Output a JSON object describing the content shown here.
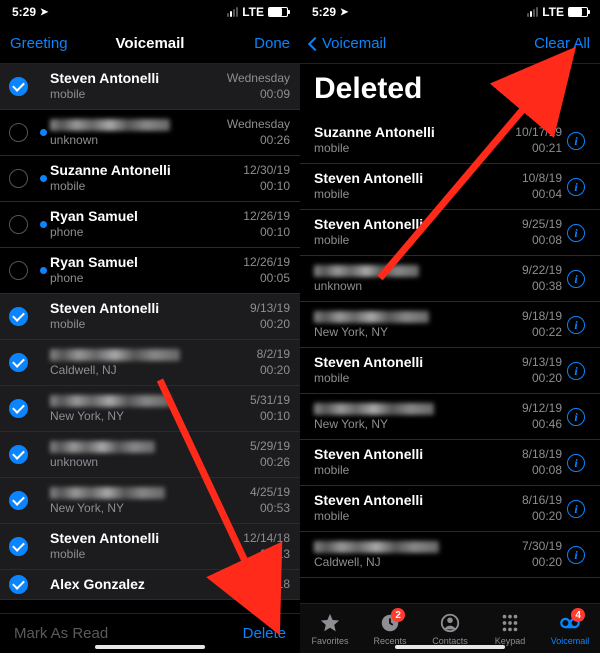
{
  "left": {
    "status": {
      "time": "5:29",
      "network": "LTE"
    },
    "nav": {
      "left": "Greeting",
      "title": "Voicemail",
      "right": "Done"
    },
    "rows": [
      {
        "name": "Steven Antonelli",
        "sub": "mobile",
        "date": "Wednesday",
        "dur": "00:09",
        "checked": true,
        "unread": false,
        "highlight": true,
        "blurred": false
      },
      {
        "name": "",
        "sub": "unknown",
        "date": "Wednesday",
        "dur": "00:26",
        "checked": false,
        "unread": true,
        "highlight": false,
        "blurred": true,
        "blurW": 120
      },
      {
        "name": "Suzanne Antonelli",
        "sub": "mobile",
        "date": "12/30/19",
        "dur": "00:10",
        "checked": false,
        "unread": true,
        "highlight": false,
        "blurred": false
      },
      {
        "name": "Ryan Samuel",
        "sub": "phone",
        "date": "12/26/19",
        "dur": "00:10",
        "checked": false,
        "unread": true,
        "highlight": false,
        "blurred": false
      },
      {
        "name": "Ryan Samuel",
        "sub": "phone",
        "date": "12/26/19",
        "dur": "00:05",
        "checked": false,
        "unread": true,
        "highlight": false,
        "blurred": false
      },
      {
        "name": "Steven Antonelli",
        "sub": "mobile",
        "date": "9/13/19",
        "dur": "00:20",
        "checked": true,
        "unread": false,
        "highlight": true,
        "blurred": false
      },
      {
        "name": "",
        "sub": "Caldwell, NJ",
        "date": "8/2/19",
        "dur": "00:20",
        "checked": true,
        "unread": false,
        "highlight": true,
        "blurred": true,
        "blurW": 130
      },
      {
        "name": "",
        "sub": "New York, NY",
        "date": "5/31/19",
        "dur": "00:10",
        "checked": true,
        "unread": false,
        "highlight": true,
        "blurred": true,
        "blurW": 120
      },
      {
        "name": "",
        "sub": "unknown",
        "date": "5/29/19",
        "dur": "00:26",
        "checked": true,
        "unread": false,
        "highlight": true,
        "blurred": true,
        "blurW": 105
      },
      {
        "name": "",
        "sub": "New York, NY",
        "date": "4/25/19",
        "dur": "00:53",
        "checked": true,
        "unread": false,
        "highlight": true,
        "blurred": true,
        "blurW": 115
      },
      {
        "name": "Steven Antonelli",
        "sub": "mobile",
        "date": "12/14/18",
        "dur": "00:13",
        "checked": true,
        "unread": false,
        "highlight": true,
        "blurred": false
      },
      {
        "name": "Alex Gonzalez",
        "sub": "",
        "date": "10/19/18",
        "dur": "",
        "checked": true,
        "unread": false,
        "highlight": true,
        "blurred": false,
        "partial": true
      }
    ],
    "toolbar": {
      "mark": "Mark As Read",
      "delete": "Delete"
    }
  },
  "right": {
    "status": {
      "time": "5:29",
      "network": "LTE"
    },
    "nav": {
      "back": "Voicemail",
      "right": "Clear All"
    },
    "title": "Deleted",
    "rows": [
      {
        "name": "Suzanne Antonelli",
        "sub": "mobile",
        "date": "10/17/19",
        "dur": "00:21",
        "blurred": false
      },
      {
        "name": "Steven Antonelli",
        "sub": "mobile",
        "date": "10/8/19",
        "dur": "00:04",
        "blurred": false
      },
      {
        "name": "Steven Antonelli",
        "sub": "mobile",
        "date": "9/25/19",
        "dur": "00:08",
        "blurred": false
      },
      {
        "name": "",
        "sub": "unknown",
        "date": "9/22/19",
        "dur": "00:38",
        "blurred": true,
        "blurW": 105
      },
      {
        "name": "",
        "sub": "New York, NY",
        "date": "9/18/19",
        "dur": "00:22",
        "blurred": true,
        "blurW": 115
      },
      {
        "name": "Steven Antonelli",
        "sub": "mobile",
        "date": "9/13/19",
        "dur": "00:20",
        "blurred": false
      },
      {
        "name": "",
        "sub": "New York, NY",
        "date": "9/12/19",
        "dur": "00:46",
        "blurred": true,
        "blurW": 120
      },
      {
        "name": "Steven Antonelli",
        "sub": "mobile",
        "date": "8/18/19",
        "dur": "00:08",
        "blurred": false
      },
      {
        "name": "Steven Antonelli",
        "sub": "mobile",
        "date": "8/16/19",
        "dur": "00:20",
        "blurred": false
      },
      {
        "name": "",
        "sub": "Caldwell, NJ",
        "date": "7/30/19",
        "dur": "00:20",
        "blurred": true,
        "blurW": 125
      }
    ],
    "tabs": {
      "favorites": "Favorites",
      "recents": "Recents",
      "contacts": "Contacts",
      "keypad": "Keypad",
      "voicemail": "Voicemail",
      "recents_badge": "2",
      "voicemail_badge": "4"
    }
  }
}
